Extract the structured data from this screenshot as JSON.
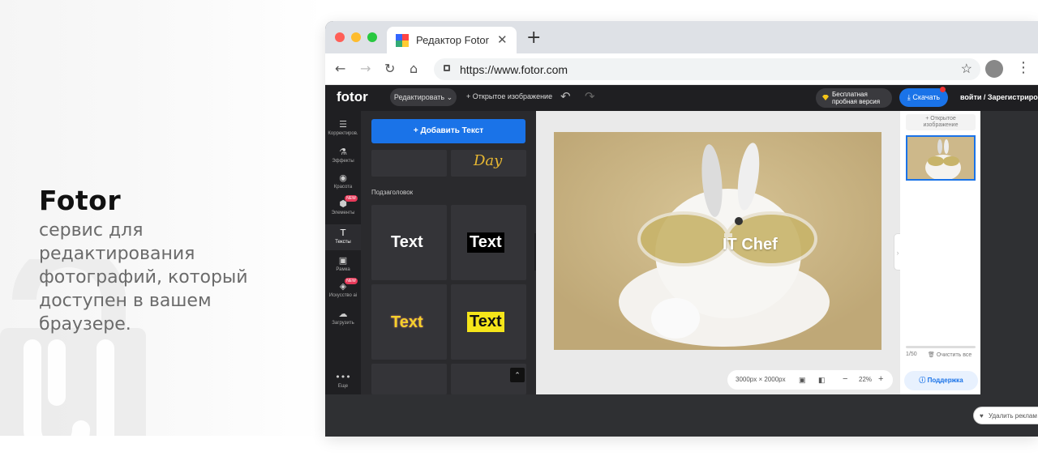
{
  "promo": {
    "title": "Fotor",
    "description": "сервис для редактирования фотографий, который доступен в вашем браузере."
  },
  "browser": {
    "tab_title": "Редактор Fotor",
    "tab_close": "✕",
    "new_tab": "+",
    "url": "https://www.fotor.com",
    "traffic_lights": [
      "#ff5f57",
      "#febc2e",
      "#28c840"
    ]
  },
  "app": {
    "logo": "fotor",
    "edit_label": "Редактировать",
    "open_image": "+ Открытое изображение",
    "trial_line1": "Бесплатная",
    "trial_line2": "пробная версия",
    "download": "Скачать",
    "login": "войти / Зарегистрирова",
    "accent_color": "#1a73e8"
  },
  "rail": [
    {
      "icon": "adjust-icon",
      "glyph": "☰",
      "label": "Корректиров."
    },
    {
      "icon": "effects-icon",
      "glyph": "⚗",
      "label": "Эффекты"
    },
    {
      "icon": "beauty-icon",
      "glyph": "◉",
      "label": "Красота"
    },
    {
      "icon": "elements-icon",
      "glyph": "⬢",
      "label": "Элементы",
      "badge": "NEW"
    },
    {
      "icon": "text-icon",
      "glyph": "T",
      "label": "Тексты",
      "active": true
    },
    {
      "icon": "frame-icon",
      "glyph": "▣",
      "label": "Рамка"
    },
    {
      "icon": "ai-art-icon",
      "glyph": "◈",
      "label": "Искусство ai",
      "badge": "NEW"
    },
    {
      "icon": "upload-icon",
      "glyph": "☁",
      "label": "Загрузить"
    },
    {
      "icon": "more-icon",
      "glyph": "•••",
      "label": "Еще"
    }
  ],
  "panel": {
    "add_text": "+ Добавить Текст",
    "script_sample": "Day",
    "subheading": "Подзаголовок",
    "samples": [
      "Text",
      "Text",
      "Text",
      "Text"
    ]
  },
  "canvas": {
    "overlay_text": "IT Chef",
    "dimensions": "3000px × 2000px",
    "zoom": "22%",
    "minus": "−",
    "plus": "+"
  },
  "right_panel": {
    "open_line1": "+ Открытое",
    "open_line2": "изображение",
    "count": "1/50",
    "clear": "Очистить все",
    "support": "Поддержка",
    "remove_ad": "Удалить реклам"
  }
}
